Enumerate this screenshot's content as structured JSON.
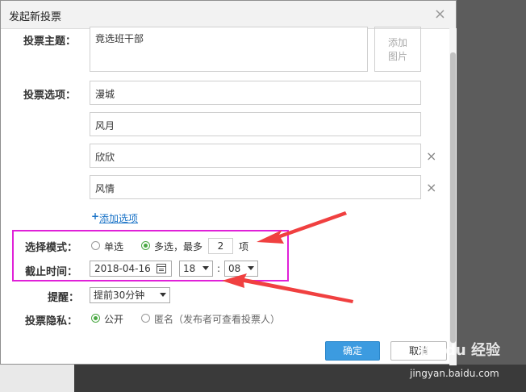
{
  "dialog": {
    "title": "发起新投票",
    "close_label": "×"
  },
  "form": {
    "topic_label": "投票主题：",
    "topic_value": "竟选班干部",
    "add_image_label_1": "添加",
    "add_image_label_2": "图片",
    "options_label": "投票选项：",
    "options": [
      "漫城",
      "风月",
      "欣欣",
      "风情"
    ],
    "remove_option_label": "×",
    "add_option_label": "添加选项",
    "mode_label": "选择模式：",
    "single_label": "单选",
    "multi_label": "多选，最多",
    "max_value": "2",
    "max_unit": "项",
    "deadline_label": "截止时间：",
    "deadline_date": "2018-04-16",
    "deadline_hour": "18",
    "deadline_minute": "08",
    "time_sep": ":",
    "reminder_label": "提醒：",
    "reminder_value": "提前30分钟",
    "privacy_label": "投票隐私：",
    "public_label": "公开",
    "anonymous_label": "匿名（发布者可查看投票人）"
  },
  "footer": {
    "ok_label": "确定",
    "cancel_label": "取消"
  },
  "watermark": {
    "brand": "Baidu 经验",
    "url": "jingyan.baidu.com"
  },
  "colors": {
    "highlight": "#e021d8",
    "arrow": "#f04040",
    "primary": "#3c9be0",
    "radio_on": "#4aa843"
  }
}
